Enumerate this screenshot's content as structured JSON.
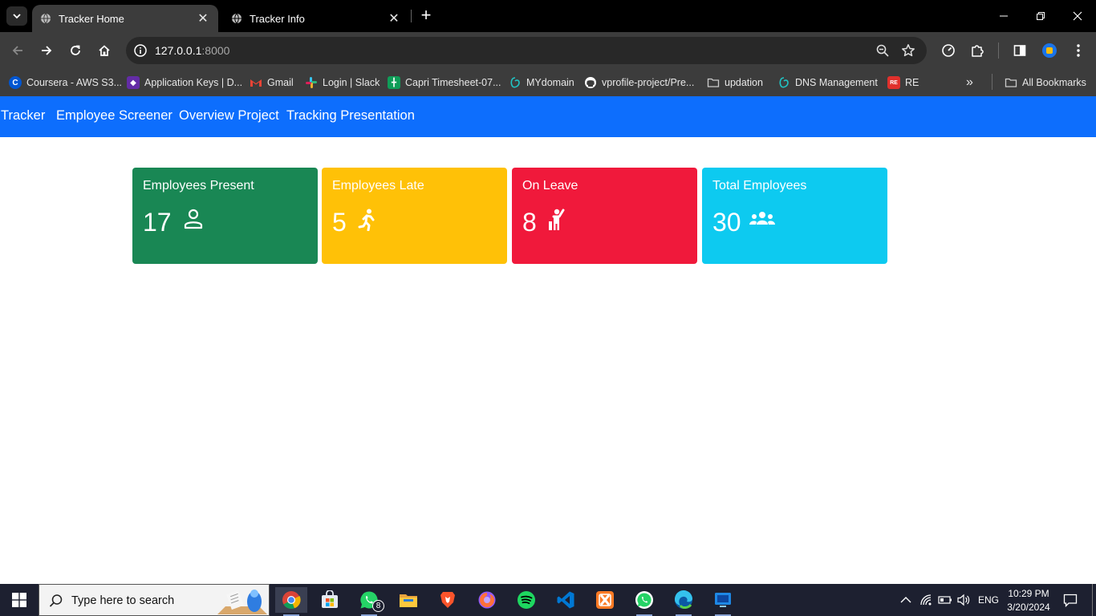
{
  "browser": {
    "tabs": [
      {
        "title": "Tracker Home",
        "active": true
      },
      {
        "title": "Tracker Info",
        "active": false
      }
    ],
    "new_tab_label": "+",
    "address": {
      "host": "127.0.0.1",
      "port": ":8000"
    },
    "bookmarks": [
      {
        "label": "Coursera - AWS S3...",
        "icon": "coursera-icon",
        "color": "#0056d2"
      },
      {
        "label": "Application Keys | D...",
        "icon": "datadog-icon",
        "color": "#632ca6"
      },
      {
        "label": "Gmail",
        "icon": "gmail-icon",
        "color": "#ea4335"
      },
      {
        "label": "Login | Slack",
        "icon": "slack-icon",
        "color": "#36c5f0"
      },
      {
        "label": "Capri Timesheet-07...",
        "icon": "sheets-icon",
        "color": "#0f9d58"
      },
      {
        "label": "MYdomain",
        "icon": "domain-icon",
        "color": "#20c4c4"
      },
      {
        "label": "vprofile-project/Pre...",
        "icon": "github-icon",
        "color": "#ffffff"
      },
      {
        "label": "updation",
        "icon": "folder-icon",
        "color": "#cccccc"
      },
      {
        "label": "DNS Management",
        "icon": "domain-icon",
        "color": "#20c4c4"
      },
      {
        "label": "RE",
        "icon": "re-icon",
        "color": "#e0302c"
      }
    ],
    "overflow_label": "»",
    "all_bookmarks_label": "All Bookmarks"
  },
  "navbar": {
    "links": [
      "Tracker",
      "Employee Screener",
      "Overview Project",
      "Tracking Presentation"
    ]
  },
  "cards": [
    {
      "title": "Employees Present",
      "value": "17",
      "icon": "person-icon",
      "color": "#198754"
    },
    {
      "title": "Employees Late",
      "value": "5",
      "icon": "running-person-icon",
      "color": "#ffc107"
    },
    {
      "title": "On Leave",
      "value": "8",
      "icon": "raised-hand-person-icon",
      "color": "#f0193b"
    },
    {
      "title": "Total Employees",
      "value": "30",
      "icon": "people-group-icon",
      "color": "#0dcaf0"
    }
  ],
  "taskbar": {
    "search_placeholder": "Type here to search",
    "apps": [
      "chrome-icon",
      "microsoft-store-icon",
      "whatsapp-icon",
      "file-explorer-icon",
      "brave-icon",
      "firefox-icon",
      "spotify-icon",
      "vscode-icon",
      "xampp-icon",
      "whatsapp-desktop-icon",
      "edge-icon",
      "tv-app-icon"
    ],
    "whatsapp_badge": "8",
    "language": "ENG",
    "time": "10:29 PM",
    "date": "3/20/2024"
  }
}
